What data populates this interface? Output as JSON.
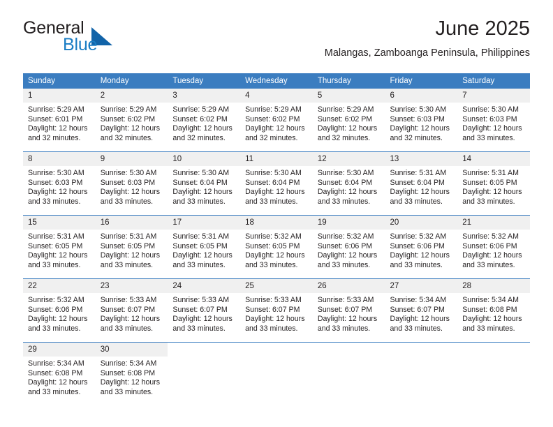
{
  "brand": {
    "name_part1": "General",
    "name_part2": "Blue",
    "logo_icon": "blue-triangle-flag-icon",
    "accent_color": "#1a7dc4"
  },
  "header": {
    "title": "June 2025",
    "subtitle": "Malangas, Zamboanga Peninsula, Philippines"
  },
  "calendar": {
    "header_bg": "#3b7dc0",
    "daynum_bg": "#f0f0f0",
    "weekdays": [
      "Sunday",
      "Monday",
      "Tuesday",
      "Wednesday",
      "Thursday",
      "Friday",
      "Saturday"
    ],
    "weeks": [
      [
        {
          "day": "1",
          "sunrise": "Sunrise: 5:29 AM",
          "sunset": "Sunset: 6:01 PM",
          "daylight": "Daylight: 12 hours and 32 minutes."
        },
        {
          "day": "2",
          "sunrise": "Sunrise: 5:29 AM",
          "sunset": "Sunset: 6:02 PM",
          "daylight": "Daylight: 12 hours and 32 minutes."
        },
        {
          "day": "3",
          "sunrise": "Sunrise: 5:29 AM",
          "sunset": "Sunset: 6:02 PM",
          "daylight": "Daylight: 12 hours and 32 minutes."
        },
        {
          "day": "4",
          "sunrise": "Sunrise: 5:29 AM",
          "sunset": "Sunset: 6:02 PM",
          "daylight": "Daylight: 12 hours and 32 minutes."
        },
        {
          "day": "5",
          "sunrise": "Sunrise: 5:29 AM",
          "sunset": "Sunset: 6:02 PM",
          "daylight": "Daylight: 12 hours and 32 minutes."
        },
        {
          "day": "6",
          "sunrise": "Sunrise: 5:30 AM",
          "sunset": "Sunset: 6:03 PM",
          "daylight": "Daylight: 12 hours and 32 minutes."
        },
        {
          "day": "7",
          "sunrise": "Sunrise: 5:30 AM",
          "sunset": "Sunset: 6:03 PM",
          "daylight": "Daylight: 12 hours and 33 minutes."
        }
      ],
      [
        {
          "day": "8",
          "sunrise": "Sunrise: 5:30 AM",
          "sunset": "Sunset: 6:03 PM",
          "daylight": "Daylight: 12 hours and 33 minutes."
        },
        {
          "day": "9",
          "sunrise": "Sunrise: 5:30 AM",
          "sunset": "Sunset: 6:03 PM",
          "daylight": "Daylight: 12 hours and 33 minutes."
        },
        {
          "day": "10",
          "sunrise": "Sunrise: 5:30 AM",
          "sunset": "Sunset: 6:04 PM",
          "daylight": "Daylight: 12 hours and 33 minutes."
        },
        {
          "day": "11",
          "sunrise": "Sunrise: 5:30 AM",
          "sunset": "Sunset: 6:04 PM",
          "daylight": "Daylight: 12 hours and 33 minutes."
        },
        {
          "day": "12",
          "sunrise": "Sunrise: 5:30 AM",
          "sunset": "Sunset: 6:04 PM",
          "daylight": "Daylight: 12 hours and 33 minutes."
        },
        {
          "day": "13",
          "sunrise": "Sunrise: 5:31 AM",
          "sunset": "Sunset: 6:04 PM",
          "daylight": "Daylight: 12 hours and 33 minutes."
        },
        {
          "day": "14",
          "sunrise": "Sunrise: 5:31 AM",
          "sunset": "Sunset: 6:05 PM",
          "daylight": "Daylight: 12 hours and 33 minutes."
        }
      ],
      [
        {
          "day": "15",
          "sunrise": "Sunrise: 5:31 AM",
          "sunset": "Sunset: 6:05 PM",
          "daylight": "Daylight: 12 hours and 33 minutes."
        },
        {
          "day": "16",
          "sunrise": "Sunrise: 5:31 AM",
          "sunset": "Sunset: 6:05 PM",
          "daylight": "Daylight: 12 hours and 33 minutes."
        },
        {
          "day": "17",
          "sunrise": "Sunrise: 5:31 AM",
          "sunset": "Sunset: 6:05 PM",
          "daylight": "Daylight: 12 hours and 33 minutes."
        },
        {
          "day": "18",
          "sunrise": "Sunrise: 5:32 AM",
          "sunset": "Sunset: 6:05 PM",
          "daylight": "Daylight: 12 hours and 33 minutes."
        },
        {
          "day": "19",
          "sunrise": "Sunrise: 5:32 AM",
          "sunset": "Sunset: 6:06 PM",
          "daylight": "Daylight: 12 hours and 33 minutes."
        },
        {
          "day": "20",
          "sunrise": "Sunrise: 5:32 AM",
          "sunset": "Sunset: 6:06 PM",
          "daylight": "Daylight: 12 hours and 33 minutes."
        },
        {
          "day": "21",
          "sunrise": "Sunrise: 5:32 AM",
          "sunset": "Sunset: 6:06 PM",
          "daylight": "Daylight: 12 hours and 33 minutes."
        }
      ],
      [
        {
          "day": "22",
          "sunrise": "Sunrise: 5:32 AM",
          "sunset": "Sunset: 6:06 PM",
          "daylight": "Daylight: 12 hours and 33 minutes."
        },
        {
          "day": "23",
          "sunrise": "Sunrise: 5:33 AM",
          "sunset": "Sunset: 6:07 PM",
          "daylight": "Daylight: 12 hours and 33 minutes."
        },
        {
          "day": "24",
          "sunrise": "Sunrise: 5:33 AM",
          "sunset": "Sunset: 6:07 PM",
          "daylight": "Daylight: 12 hours and 33 minutes."
        },
        {
          "day": "25",
          "sunrise": "Sunrise: 5:33 AM",
          "sunset": "Sunset: 6:07 PM",
          "daylight": "Daylight: 12 hours and 33 minutes."
        },
        {
          "day": "26",
          "sunrise": "Sunrise: 5:33 AM",
          "sunset": "Sunset: 6:07 PM",
          "daylight": "Daylight: 12 hours and 33 minutes."
        },
        {
          "day": "27",
          "sunrise": "Sunrise: 5:34 AM",
          "sunset": "Sunset: 6:07 PM",
          "daylight": "Daylight: 12 hours and 33 minutes."
        },
        {
          "day": "28",
          "sunrise": "Sunrise: 5:34 AM",
          "sunset": "Sunset: 6:08 PM",
          "daylight": "Daylight: 12 hours and 33 minutes."
        }
      ],
      [
        {
          "day": "29",
          "sunrise": "Sunrise: 5:34 AM",
          "sunset": "Sunset: 6:08 PM",
          "daylight": "Daylight: 12 hours and 33 minutes."
        },
        {
          "day": "30",
          "sunrise": "Sunrise: 5:34 AM",
          "sunset": "Sunset: 6:08 PM",
          "daylight": "Daylight: 12 hours and 33 minutes."
        },
        {
          "day": "",
          "sunrise": "",
          "sunset": "",
          "daylight": ""
        },
        {
          "day": "",
          "sunrise": "",
          "sunset": "",
          "daylight": ""
        },
        {
          "day": "",
          "sunrise": "",
          "sunset": "",
          "daylight": ""
        },
        {
          "day": "",
          "sunrise": "",
          "sunset": "",
          "daylight": ""
        },
        {
          "day": "",
          "sunrise": "",
          "sunset": "",
          "daylight": ""
        }
      ]
    ]
  }
}
